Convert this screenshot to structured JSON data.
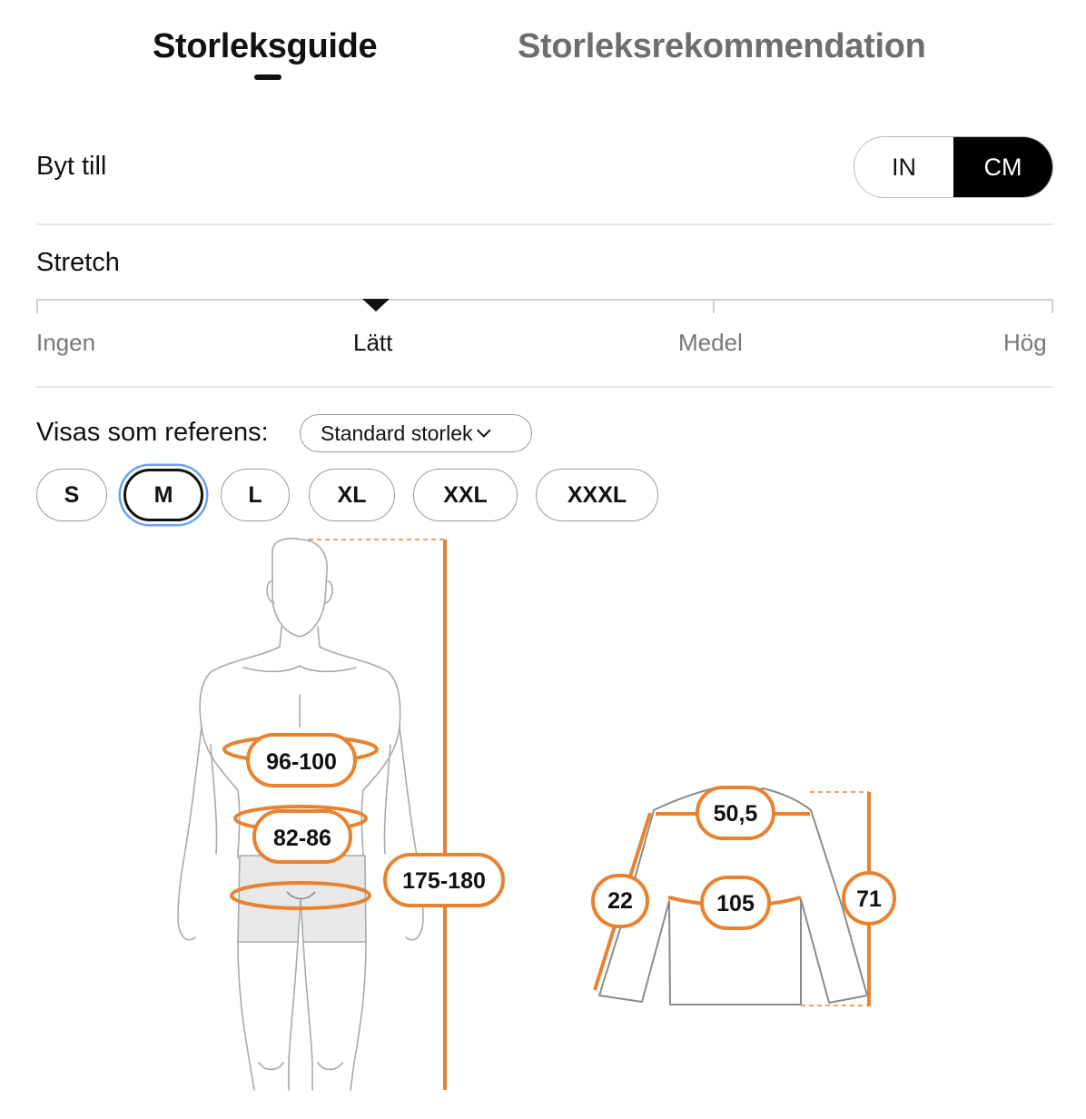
{
  "tabs": [
    {
      "label": "Storleksguide",
      "active": true
    },
    {
      "label": "Storleksrekommendation",
      "active": false
    }
  ],
  "unit": {
    "label": "Byt till",
    "options": [
      "IN",
      "CM"
    ],
    "selected": "CM"
  },
  "stretch": {
    "label": "Stretch",
    "levels": [
      "Ingen",
      "Lätt",
      "Medel",
      "Hög"
    ],
    "selected": "Lätt"
  },
  "reference": {
    "label": "Visas som referens:",
    "dropdown_value": "Standard storlek",
    "sizes": [
      "S",
      "M",
      "L",
      "XL",
      "XXL",
      "XXXL"
    ],
    "selected_size": "M"
  },
  "body_measurements": {
    "chest": "96-100",
    "waist": "82-86",
    "height": "175-180"
  },
  "garment_measurements": {
    "shoulder": "50,5",
    "sleeve": "22",
    "chest": "105",
    "length": "71"
  },
  "colors": {
    "accent": "#e8822f",
    "selected_ring": "#6da0f4"
  }
}
